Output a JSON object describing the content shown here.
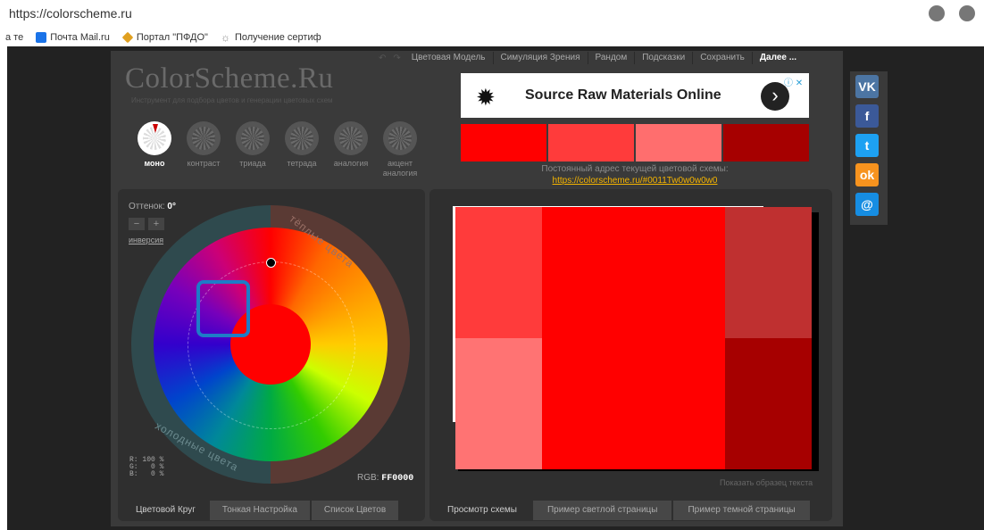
{
  "browser": {
    "url": "https://colorscheme.ru",
    "bookmarks": [
      {
        "label": "а те",
        "icon": "text-fragment"
      },
      {
        "label": "Почта Mail.ru",
        "icon": "mail-icon"
      },
      {
        "label": "Портал \"ПФДО\"",
        "icon": "diamond-icon"
      },
      {
        "label": "Получение сертиф",
        "icon": "sun-icon"
      }
    ]
  },
  "site": {
    "logo": "ColorScheme.Ru",
    "tagline": "Инструмент для подбора цветов и генерации цветовых схем"
  },
  "nav": {
    "items": [
      "Цветовая Модель",
      "Симуляция Зрения",
      "Рандом",
      "Подсказки",
      "Сохранить"
    ],
    "more": "Далее ..."
  },
  "modes": [
    {
      "label": "моно",
      "active": true
    },
    {
      "label": "контраст",
      "active": false
    },
    {
      "label": "триада",
      "active": false
    },
    {
      "label": "тетрада",
      "active": false
    },
    {
      "label": "аналогия",
      "active": false
    },
    {
      "label": "акцент аналогия",
      "active": false
    }
  ],
  "wheel": {
    "hue_label": "Оттенок:",
    "hue_value": "0°",
    "minus": "−",
    "plus": "+",
    "inversion": "инверсия",
    "warm": "тёплые цвета",
    "cold": "холодные цвета",
    "rgb_pct": "R: 100 %\nG:   0 %\nB:   0 %",
    "rgb_label": "RGB:",
    "rgb_hex": "FF0000",
    "center_color": "#ff0000"
  },
  "left_tabs": [
    "Цветовой Круг",
    "Тонкая Настройка",
    "Список Цветов"
  ],
  "ad": {
    "text": "Source Raw Materials Online",
    "arrow": "›",
    "info": "ⓘ ✕"
  },
  "swatches": [
    "#ff0000",
    "#ff3b3b",
    "#ff6e6e",
    "#a60000"
  ],
  "permalink": {
    "label": "Постоянный адрес текущей цветовой схемы:",
    "url": "https://colorscheme.ru/#0011Tw0w0w0w0"
  },
  "preview": {
    "show_sample": "Показать образец текста",
    "colors": {
      "main": "#ff0000",
      "light1": "#ff3b3b",
      "light2": "#ff7373",
      "dark1": "#bf3030",
      "dark2": "#a60000"
    }
  },
  "right_tabs": [
    "Просмотр схемы",
    "Пример светлой страницы",
    "Пример темной страницы"
  ],
  "social": [
    {
      "label": "vk",
      "color": "#4c75a3",
      "icon": "vk-icon"
    },
    {
      "label": "f",
      "color": "#3b5998",
      "icon": "facebook-icon"
    },
    {
      "label": "t",
      "color": "#1da1f2",
      "icon": "twitter-icon"
    },
    {
      "label": "ok",
      "color": "#f7931e",
      "icon": "odnoklassniki-icon"
    },
    {
      "label": "@",
      "color": "#168de2",
      "icon": "mailru-icon"
    }
  ]
}
